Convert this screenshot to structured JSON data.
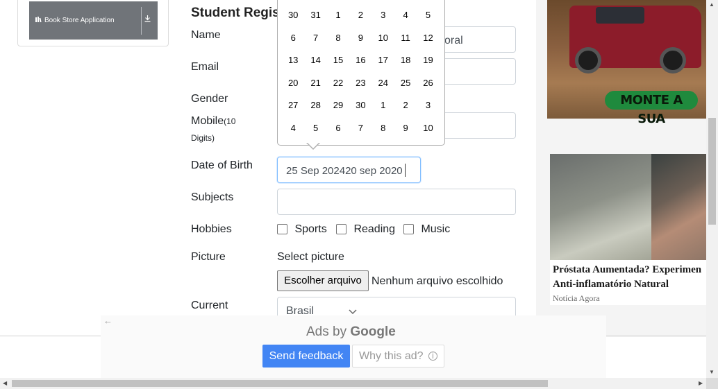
{
  "sidebar": {
    "book_store_label": "Book Store Application",
    "book_icon": "book-icon",
    "download_icon": "download-icon"
  },
  "form": {
    "title": "Student Regis",
    "labels": {
      "name": "Name",
      "email": "Email",
      "gender": "Gender",
      "mobile": "Mobile",
      "mobile_hint_1": "(10",
      "mobile_hint_2": "Digits)",
      "dob": "Date of Birth",
      "subjects": "Subjects",
      "hobbies": "Hobbies",
      "picture": "Picture",
      "current": "Current"
    },
    "name_value_partial": "oral",
    "dob_value": "25 Sep 202420 sep 2020",
    "hobbies": [
      "Sports",
      "Reading",
      "Music"
    ],
    "picture_select_label": "Select picture",
    "file_button": "Escolher arquivo",
    "file_status": "Nenhum arquivo escolhido",
    "current_select_value": "Brasil"
  },
  "calendar": {
    "days": [
      "30",
      "31",
      "1",
      "2",
      "3",
      "4",
      "5",
      "6",
      "7",
      "8",
      "9",
      "10",
      "11",
      "12",
      "13",
      "14",
      "15",
      "16",
      "17",
      "18",
      "19",
      "20",
      "21",
      "22",
      "23",
      "24",
      "25",
      "26",
      "27",
      "28",
      "29",
      "30",
      "1",
      "2",
      "3",
      "4",
      "5",
      "6",
      "7",
      "8",
      "9",
      "10"
    ],
    "selected": "25",
    "selected_color": "#216ba5"
  },
  "ads": {
    "truck_cta": "MONTE A SUA",
    "article_title_1": "Próstata Aumentada? Experimen",
    "article_title_2": "Anti-inflamatório Natural",
    "article_source": "Notícia Agora",
    "ads_by": "Ads by",
    "google": "Google",
    "send_feedback": "Send feedback",
    "why_this_ad": "Why this ad?",
    "feedback_color": "#4285f4"
  }
}
